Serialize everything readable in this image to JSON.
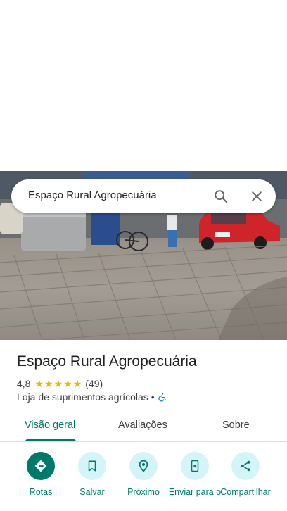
{
  "search": {
    "query": "Espaço Rural Agropecuária"
  },
  "place": {
    "title": "Espaço Rural Agropecuária",
    "rating": "4,8",
    "stars": 5,
    "review_count": "(49)",
    "category": "Loja de suprimentos agrícolas",
    "separator": "•"
  },
  "tabs": [
    {
      "label": "Visão geral",
      "active": true
    },
    {
      "label": "Avaliações",
      "active": false
    },
    {
      "label": "Sobre",
      "active": false
    }
  ],
  "actions": [
    {
      "label": "Rotas",
      "icon": "directions-icon"
    },
    {
      "label": "Salvar",
      "icon": "bookmark-icon"
    },
    {
      "label": "Próximo",
      "icon": "nearby-icon"
    },
    {
      "label": "Enviar para o",
      "icon": "send-to-phone-icon"
    },
    {
      "label": "Compartilhar",
      "icon": "share-icon"
    }
  ],
  "colors": {
    "accent": "#00796b",
    "action_bg": "#d3f5fa",
    "star": "#f4b400",
    "accessibility": "#1a73e8"
  }
}
